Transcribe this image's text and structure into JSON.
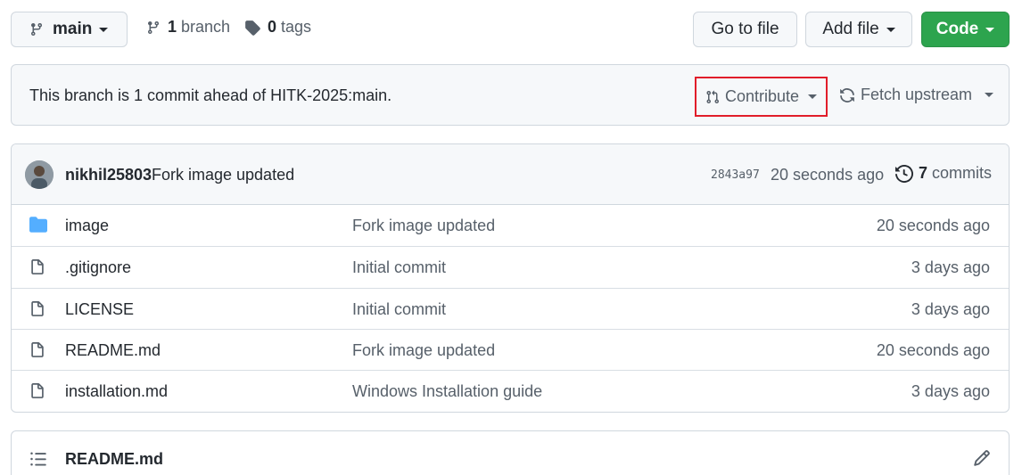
{
  "toolbar": {
    "branch_label": "main",
    "branches_count": "1",
    "branches_text": "branch",
    "tags_count": "0",
    "tags_text": "tags",
    "go_to_file": "Go to file",
    "add_file": "Add file",
    "code": "Code",
    "code_color": "#2da44e"
  },
  "ahead_banner": {
    "text": "This branch is 1 commit ahead of HITK-2025:main.",
    "contribute": "Contribute",
    "fetch_upstream": "Fetch upstream",
    "highlight_color": "#e11d2a"
  },
  "latest_commit": {
    "author": "nikhil25803",
    "message": "Fork image updated",
    "sha": "2843a97",
    "time": "20 seconds ago",
    "commits_count": "7",
    "commits_text": "commits"
  },
  "files": [
    {
      "name": "image",
      "type": "folder-icon",
      "message": "Fork image updated",
      "time": "20 seconds ago"
    },
    {
      "name": ".gitignore",
      "type": "file-icon",
      "message": "Initial commit",
      "time": "3 days ago"
    },
    {
      "name": "LICENSE",
      "type": "file-icon",
      "message": "Initial commit",
      "time": "3 days ago"
    },
    {
      "name": "README.md",
      "type": "file-icon",
      "message": "Fork image updated",
      "time": "20 seconds ago"
    },
    {
      "name": "installation.md",
      "type": "file-icon",
      "message": "Windows Installation guide",
      "time": "3 days ago"
    }
  ],
  "readme": {
    "title": "README.md"
  }
}
